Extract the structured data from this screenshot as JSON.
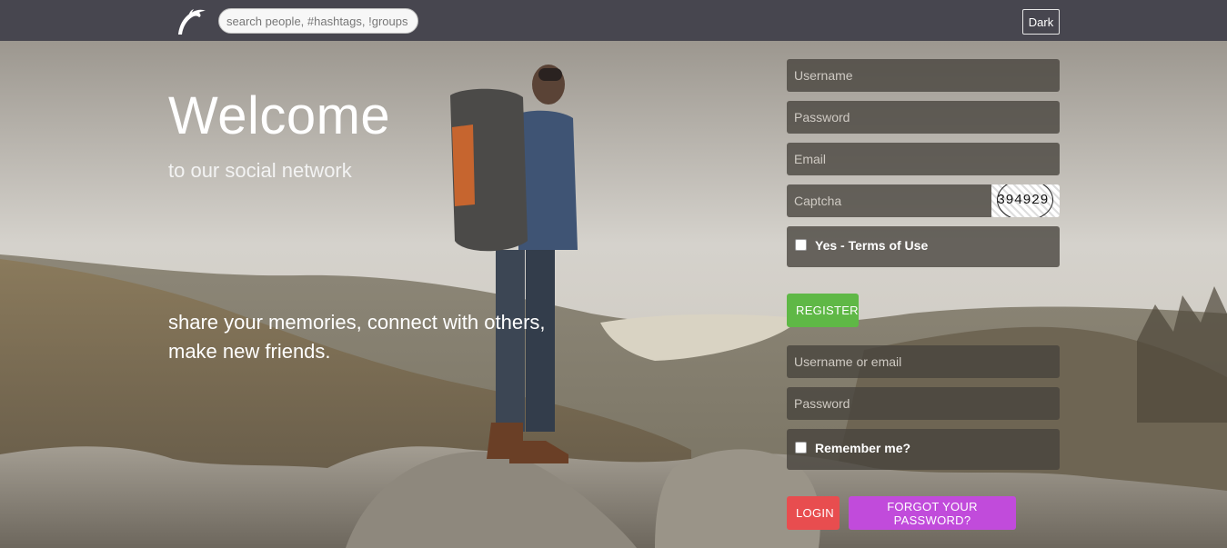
{
  "header": {
    "search_placeholder": "search people, #hashtags, !groups",
    "theme_button": "Dark",
    "logo_icon": "dolphin-logo-icon"
  },
  "hero": {
    "title": "Welcome",
    "subtitle": "to our social network",
    "tagline_line1": "share your memories, connect with others,",
    "tagline_line2": "make new friends."
  },
  "register": {
    "username_placeholder": "Username",
    "password_placeholder": "Password",
    "email_placeholder": "Email",
    "captcha_placeholder": "Captcha",
    "captcha_code": "394929",
    "terms_label": "Yes - Terms of Use",
    "button": "REGISTER"
  },
  "login": {
    "username_placeholder": "Username or email",
    "password_placeholder": "Password",
    "remember_label": "Remember me?",
    "login_button": "LOGIN",
    "forgot_button": "FORGOT YOUR PASSWORD?"
  },
  "colors": {
    "topbar": "#47464f",
    "register": "#5fb846",
    "login": "#e84d4f",
    "forgot": "#c14bdb"
  }
}
